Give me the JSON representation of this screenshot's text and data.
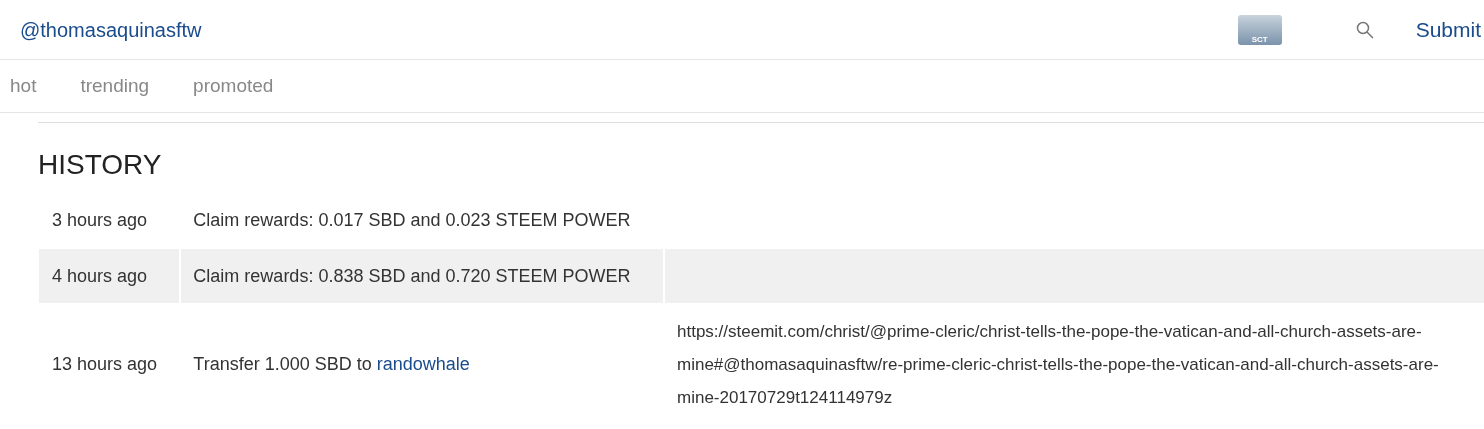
{
  "header": {
    "username": "@thomasaquinasftw",
    "logo_text": "SCT",
    "submit": "Submit"
  },
  "tabs": [
    {
      "label": "hot",
      "selected": false
    },
    {
      "label": "trending",
      "selected": false
    },
    {
      "label": "promoted",
      "selected": false
    }
  ],
  "history": {
    "title": "HISTORY",
    "rows": [
      {
        "time": "3 hours ago",
        "description": "Claim rewards: 0.017 SBD and 0.023 STEEM POWER"
      },
      {
        "time": "4 hours ago",
        "description": "Claim rewards: 0.838 SBD and 0.720 STEEM POWER"
      },
      {
        "time": "13 hours ago",
        "description": "Transfer 1.000 SBD to ",
        "link": "randowhale",
        "memo": "https://steemit.com/christ/@prime-cleric/christ-tells-the-pope-the-vatican-and-all-church-assets-are-mine#@thomasaquinasftw/re-prime-cleric-christ-tells-the-pope-the-vatican-and-all-church-assets-are-mine-20170729t124114979z"
      }
    ]
  }
}
